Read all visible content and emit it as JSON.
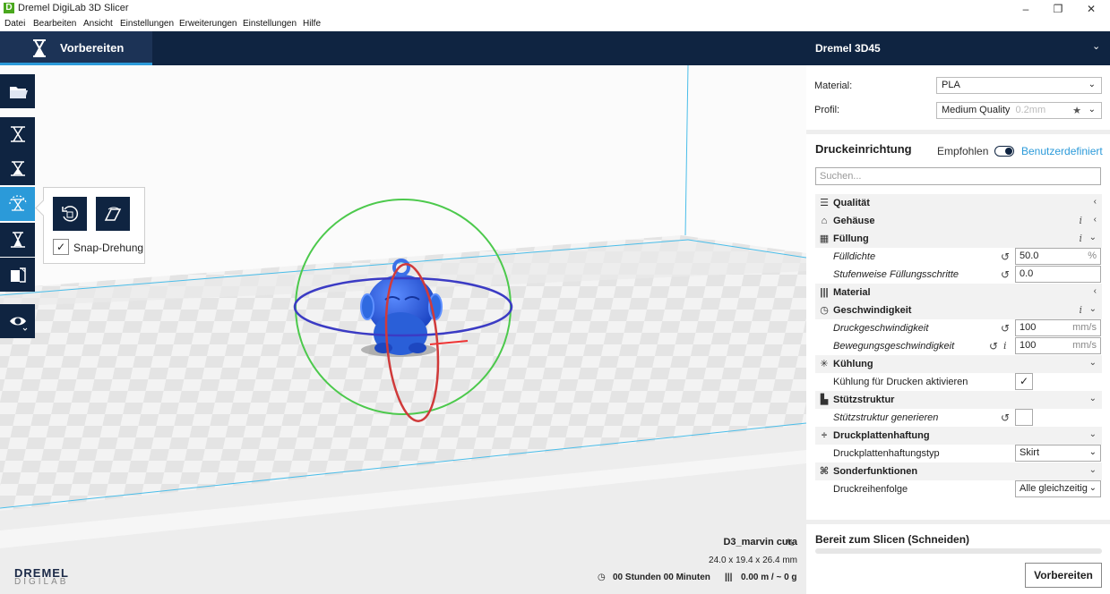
{
  "window": {
    "title": "Dremel DigiLab 3D Slicer",
    "minimize": "–",
    "maximize": "❐",
    "close": "✕",
    "app_icon": "D"
  },
  "menu": [
    "Datei",
    "Bearbeiten",
    "Ansicht",
    "Einstellungen",
    "Erweiterungen",
    "Einstellungen",
    "Hilfe"
  ],
  "topbar": {
    "tab_label": "Vorbereiten",
    "printer_name": "Dremel 3D45",
    "printer_chevron": "⌄"
  },
  "rotate_panel": {
    "snap_label": "Snap-Drehung",
    "snap_checked": "✓"
  },
  "object": {
    "name": "D3_marvin cura",
    "dimensions": "24.0 x 19.4 x 26.4 mm"
  },
  "stats": {
    "time": "00 Stunden 00 Minuten",
    "material": "0.00 m / ~ 0 g"
  },
  "logo": {
    "top": "DREMEL",
    "bottom": "DIGILAB"
  },
  "panel": {
    "material_label": "Material:",
    "material_value": "PLA",
    "profile_label": "Profil:",
    "profile_value": "Medium Quality",
    "profile_sub": "0.2mm",
    "setup_title": "Druckeinrichtung",
    "mode_recommended": "Empfohlen",
    "mode_custom": "Benutzerdefiniert",
    "search_placeholder": "Suchen...",
    "slice_title": "Bereit zum Slicen (Schneiden)",
    "prepare_button": "Vorbereiten"
  },
  "settings": {
    "quality": "Qualität",
    "shell": "Gehäuse",
    "infill": "Füllung",
    "infill_density": "Fülldichte",
    "infill_density_value": "50.0",
    "infill_density_unit": "%",
    "gradual_infill": "Stufenweise Füllungsschritte",
    "gradual_infill_value": "0.0",
    "material": "Material",
    "speed": "Geschwindigkeit",
    "print_speed": "Druckgeschwindigkeit",
    "print_speed_value": "100",
    "travel_speed": "Bewegungsgeschwindigkeit",
    "travel_speed_value": "100",
    "speed_unit": "mm/s",
    "cooling": "Kühlung",
    "enable_cooling": "Kühlung für Drucken aktivieren",
    "enable_cooling_checked": "✓",
    "support": "Stützstruktur",
    "generate_support": "Stützstruktur generieren",
    "adhesion": "Druckplattenhaftung",
    "adhesion_type": "Druckplattenhaftungstyp",
    "adhesion_type_value": "Skirt",
    "special": "Sonderfunktionen",
    "print_sequence": "Druckreihenfolge",
    "print_sequence_value": "Alle gleichzeitig",
    "info_glyph": "i",
    "reset_glyph": "↺"
  },
  "colors": {
    "navy": "#0f2441",
    "accent": "#2b9ad9",
    "model": "#2a5fd8"
  }
}
